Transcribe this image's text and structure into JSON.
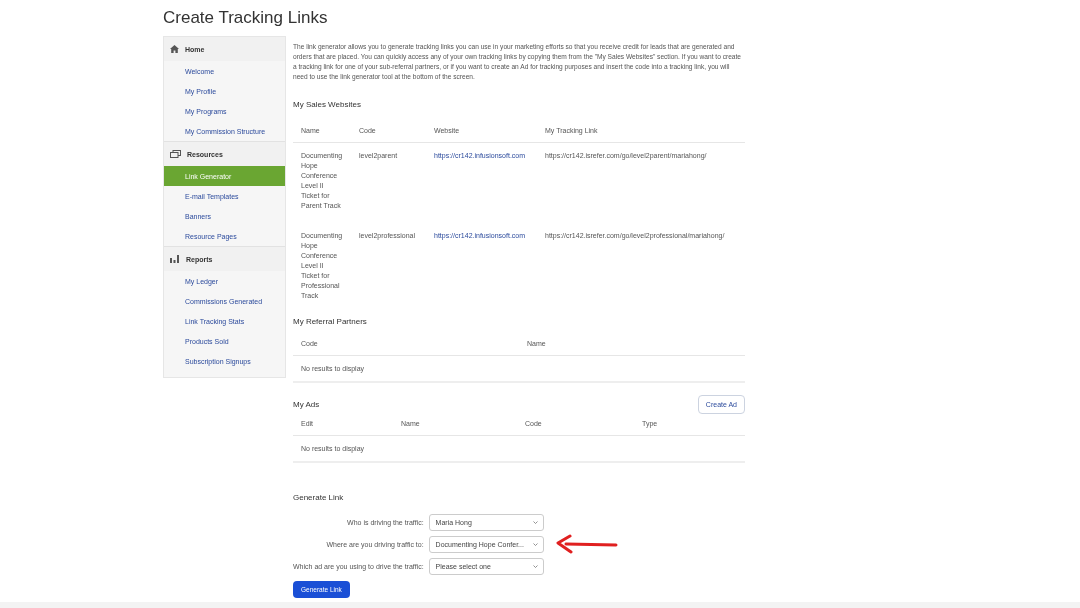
{
  "page_title": "Create Tracking Links",
  "sidebar": [
    {
      "kind": "home",
      "title": "Home",
      "items": [
        {
          "label": "Welcome",
          "selected": false
        },
        {
          "label": "My Profile",
          "selected": false
        },
        {
          "label": "My Programs",
          "selected": false
        },
        {
          "label": "My Commission Structure",
          "selected": false
        }
      ]
    },
    {
      "kind": "resources",
      "title": "Resources",
      "items": [
        {
          "label": "Link Generator",
          "selected": true
        },
        {
          "label": "E-mail Templates",
          "selected": false
        },
        {
          "label": "Banners",
          "selected": false
        },
        {
          "label": "Resource Pages",
          "selected": false
        }
      ]
    },
    {
      "kind": "reports",
      "title": "Reports",
      "items": [
        {
          "label": "My Ledger",
          "selected": false
        },
        {
          "label": "Commissions Generated",
          "selected": false
        },
        {
          "label": "Link Tracking Stats",
          "selected": false
        },
        {
          "label": "Products Sold",
          "selected": false
        },
        {
          "label": "Subscription Signups",
          "selected": false
        }
      ]
    }
  ],
  "intro": "The link generator allows you to generate tracking links you can use in your marketing efforts so that you receive credit for leads that are generated and orders that are placed. You can quickly access any of your own tracking links by copying them from the \"My Sales Websites\" section. If you want to create a tracking link for one of your sub-referral partners, or if you want to create an Ad for tracking purposes and insert the code into a tracking link, you will need to use the link generator tool at the bottom of the screen.",
  "sales_websites": {
    "title": "My Sales Websites",
    "columns": [
      "Name",
      "Code",
      "Website",
      "My Tracking Link"
    ],
    "rows": [
      {
        "name": "Documenting Hope Conference Level II Ticket for Parent Track",
        "code": "level2parent",
        "website": "https://cr142.infusionsoft.com",
        "tracking_link": "https://cr142.isrefer.com/go/level2parent/mariahong/"
      },
      {
        "name": "Documenting Hope Conference Level II Ticket for Professional Track",
        "code": "level2professional",
        "website": "https://cr142.infusionsoft.com",
        "tracking_link": "https://cr142.isrefer.com/go/level2professional/mariahong/"
      }
    ]
  },
  "referral_partners": {
    "title": "My Referral Partners",
    "columns": [
      "Code",
      "Name"
    ],
    "empty": "No results to display"
  },
  "ads": {
    "title": "My Ads",
    "button": "Create Ad",
    "columns": [
      "Edit",
      "Name",
      "Code",
      "Type"
    ],
    "empty": "No results to display"
  },
  "generate_link": {
    "title": "Generate Link",
    "fields": [
      {
        "label": "Who is driving the traffic:",
        "value": "Maria Hong"
      },
      {
        "label": "Where are you driving traffic to:",
        "value": "Documenting Hope Confer..."
      },
      {
        "label": "Which ad are you using to drive the traffic:",
        "value": "Please select one"
      }
    ],
    "button": "Generate Link"
  }
}
